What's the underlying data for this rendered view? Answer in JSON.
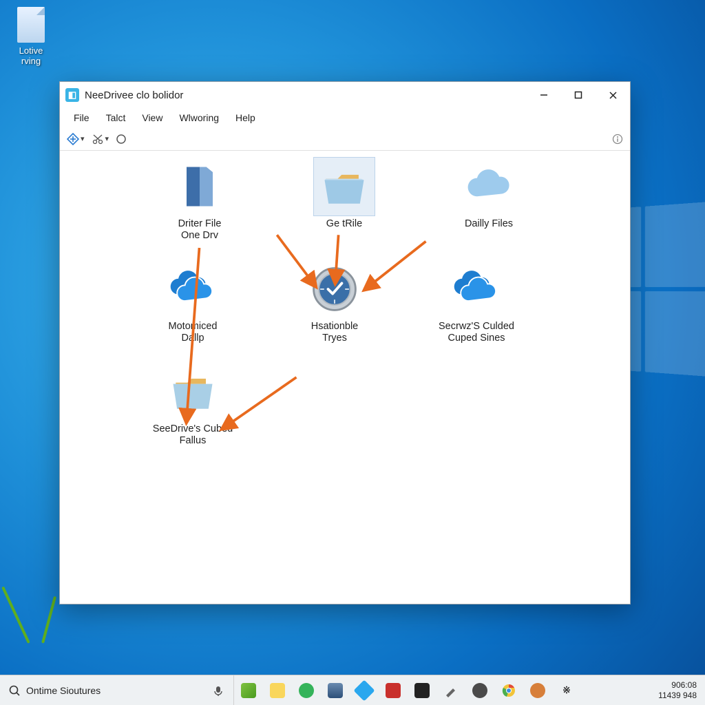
{
  "desktop": {
    "icon_label": "Lotive\nrving"
  },
  "window": {
    "title": "NeeDrivee clo bolidor",
    "menu": {
      "file": "File",
      "talt": "Talct",
      "view": "View",
      "wlworing": "Wlworing",
      "help": "Help"
    },
    "items": {
      "driter": "Driter File\nOne Drv",
      "getitle": "Ge tRile",
      "dailly": "Dailly Files",
      "motomiced": "Motomiced\nDallp",
      "hsationble": "Hsationble\nTryes",
      "secrwz": "Secrwz'S Culded\nCuped Sines",
      "seedrive": "SeeDrive's Cubed\nFallus"
    }
  },
  "taskbar": {
    "search_placeholder": "Ontime Sioutures",
    "clock_time": "906:08",
    "clock_date": "11439 948"
  }
}
